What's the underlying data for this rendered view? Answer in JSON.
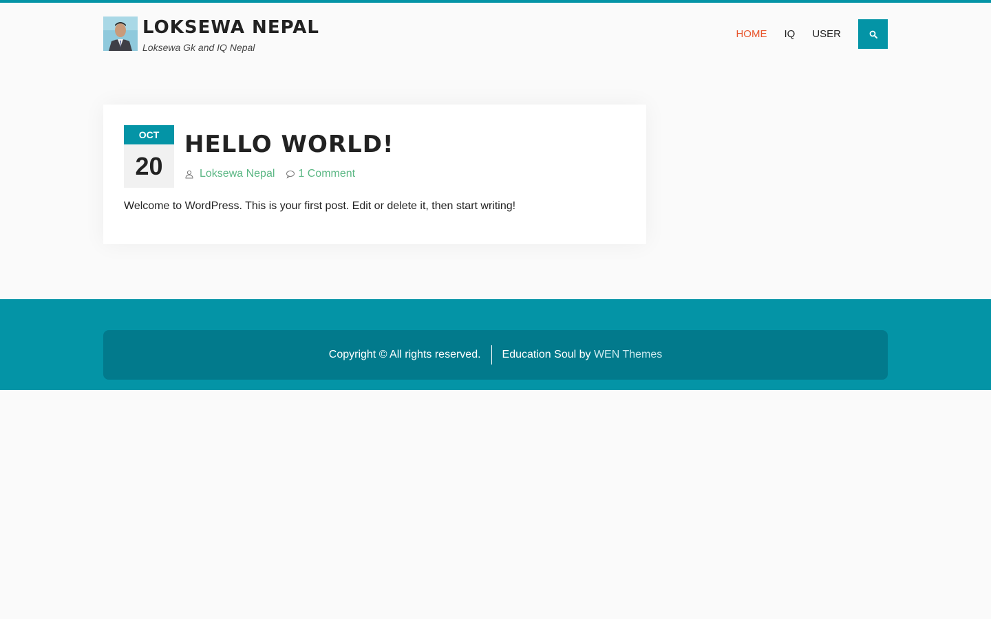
{
  "site": {
    "title": "LOKSEWA NEPAL",
    "tagline": "Loksewa Gk and IQ Nepal"
  },
  "nav": {
    "items": [
      {
        "label": "HOME",
        "active": true
      },
      {
        "label": "IQ",
        "active": false
      },
      {
        "label": "USER",
        "active": false
      }
    ],
    "search_icon": "search-icon"
  },
  "post": {
    "date_month": "OCT",
    "date_day": "20",
    "title": "HELLO WORLD!",
    "author": "Loksewa Nepal",
    "comments": "1 Comment",
    "excerpt": "Welcome to WordPress. This is your first post. Edit or delete it, then start writing!"
  },
  "footer": {
    "copyright": "Copyright © All rights reserved.",
    "credit_text": "Education Soul by ",
    "credit_link": "WEN Themes"
  },
  "colors": {
    "accent": "#0494a6",
    "footer_inner": "#027a8c",
    "nav_active": "#e8542b",
    "meta_link": "#5bb784",
    "background": "#fafafa"
  }
}
